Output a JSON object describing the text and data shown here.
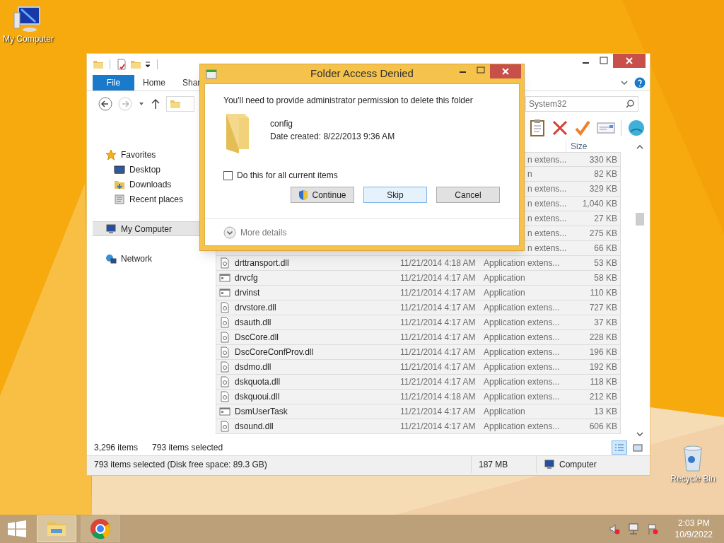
{
  "desktop_icons": [
    {
      "label": "My Computer",
      "kind": "computer"
    },
    {
      "label": "Recycle Bin",
      "kind": "recycle-bin"
    }
  ],
  "explorer": {
    "ribbon_tabs": [
      {
        "label": "File",
        "kind": "menu"
      },
      {
        "label": "Home",
        "kind": "tab"
      },
      {
        "label": "Shar",
        "kind": "tab"
      }
    ],
    "search": {
      "placeholder": "System32"
    },
    "sidebar": [
      {
        "label": "Favorites",
        "kind": "favorites",
        "selected": false,
        "children": [
          {
            "label": "Desktop",
            "kind": "desktop",
            "selected": false
          },
          {
            "label": "Downloads",
            "kind": "downloads",
            "selected": false
          },
          {
            "label": "Recent places",
            "kind": "recent",
            "selected": false
          }
        ]
      },
      {
        "label": "My Computer",
        "kind": "computer",
        "selected": true
      },
      {
        "label": "Network",
        "kind": "network",
        "selected": false
      }
    ],
    "column_header": "Size",
    "rows": [
      {
        "kind": "partial",
        "type": "n extens...",
        "size": "330 KB"
      },
      {
        "kind": "partial",
        "type": "n",
        "size": "82 KB"
      },
      {
        "kind": "partial",
        "type": "n extens...",
        "size": "329 KB"
      },
      {
        "kind": "partial",
        "type": "n extens...",
        "size": "1,040 KB"
      },
      {
        "kind": "partial",
        "type": "n extens...",
        "size": "27 KB"
      },
      {
        "kind": "partial",
        "type": "n extens...",
        "size": "275 KB"
      },
      {
        "kind": "partial",
        "type": "n extens...",
        "size": "66 KB"
      },
      {
        "kind": "library",
        "name": "drttransport.dll",
        "date": "11/21/2014 4:18 AM",
        "type": "Application extens...",
        "size": "53 KB"
      },
      {
        "kind": "program",
        "name": "drvcfg",
        "date": "11/21/2014 4:17 AM",
        "type": "Application",
        "size": "58 KB"
      },
      {
        "kind": "program",
        "name": "drvinst",
        "date": "11/21/2014 4:17 AM",
        "type": "Application",
        "size": "110 KB"
      },
      {
        "kind": "library",
        "name": "drvstore.dll",
        "date": "11/21/2014 4:17 AM",
        "type": "Application extens...",
        "size": "727 KB"
      },
      {
        "kind": "library",
        "name": "dsauth.dll",
        "date": "11/21/2014 4:17 AM",
        "type": "Application extens...",
        "size": "37 KB"
      },
      {
        "kind": "library",
        "name": "DscCore.dll",
        "date": "11/21/2014 4:17 AM",
        "type": "Application extens...",
        "size": "228 KB"
      },
      {
        "kind": "library",
        "name": "DscCoreConfProv.dll",
        "date": "11/21/2014 4:17 AM",
        "type": "Application extens...",
        "size": "196 KB"
      },
      {
        "kind": "library",
        "name": "dsdmo.dll",
        "date": "11/21/2014 4:17 AM",
        "type": "Application extens...",
        "size": "192 KB"
      },
      {
        "kind": "library",
        "name": "dskquota.dll",
        "date": "11/21/2014 4:17 AM",
        "type": "Application extens...",
        "size": "118 KB"
      },
      {
        "kind": "library",
        "name": "dskquoui.dll",
        "date": "11/21/2014 4:18 AM",
        "type": "Application extens...",
        "size": "212 KB"
      },
      {
        "kind": "program",
        "name": "DsmUserTask",
        "date": "11/21/2014 4:17 AM",
        "type": "Application",
        "size": "13 KB"
      },
      {
        "kind": "library",
        "name": "dsound.dll",
        "date": "11/21/2014 4:17 AM",
        "type": "Application extens...",
        "size": "606 KB"
      }
    ],
    "item_count": "3,296 items",
    "selection_count": "793 items selected",
    "view_buttons": [
      {
        "kind": "details",
        "selected": true
      },
      {
        "kind": "large-icons",
        "selected": false
      }
    ],
    "status_bar": {
      "selection": "793 items selected (Disk free space: 89.3 GB)",
      "size": "187 MB",
      "location": "Computer"
    }
  },
  "dialog": {
    "title": "Folder Access Denied",
    "message": "You'll need to provide administrator permission to delete this folder",
    "item_name": "config",
    "item_date": "Date created: 8/22/2013 9:36 AM",
    "checkbox": {
      "label": "Do this for all current items",
      "checked": false
    },
    "buttons": [
      {
        "label": "Continue",
        "kind": "elevated"
      },
      {
        "label": "Skip",
        "kind": "default"
      },
      {
        "label": "Cancel",
        "kind": "plain"
      }
    ],
    "more_details": "More details"
  },
  "taskbar": {
    "apps": [
      {
        "kind": "explorer",
        "selected": true
      },
      {
        "kind": "chrome",
        "selected": false
      }
    ],
    "time": "2:03 PM",
    "date": "10/9/2022"
  }
}
